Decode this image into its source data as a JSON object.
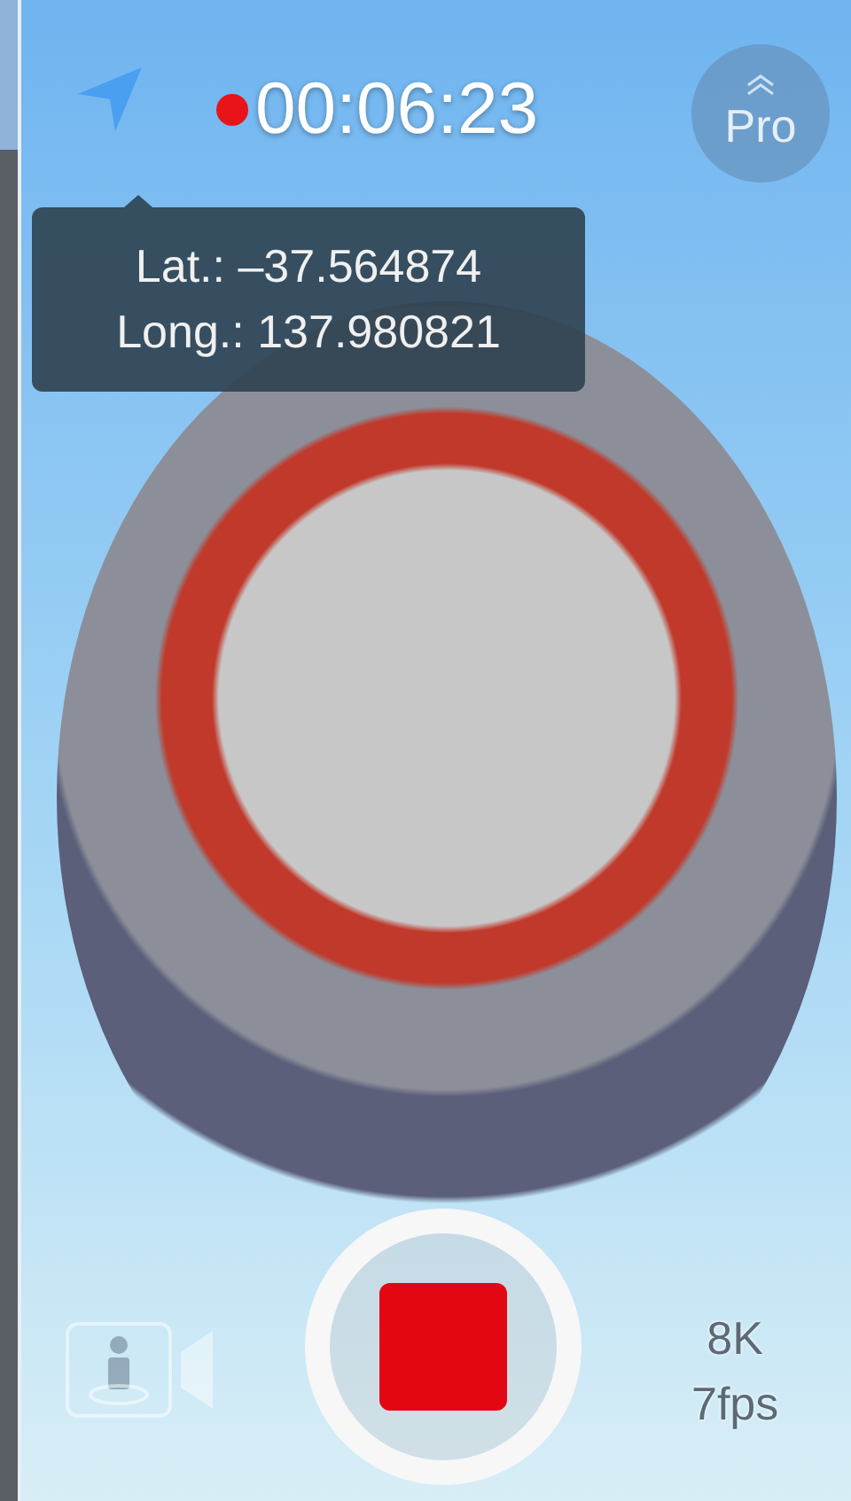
{
  "recording": {
    "on": true,
    "time": "00:06:23"
  },
  "pro_button": {
    "label": "Pro"
  },
  "location_tooltip": {
    "lines": [
      "Lat.: –37.564874",
      "Long.: 137.980821"
    ]
  },
  "record_button": {
    "recording": true
  },
  "resolution": {
    "label": "8K",
    "framerate": "7fps"
  }
}
